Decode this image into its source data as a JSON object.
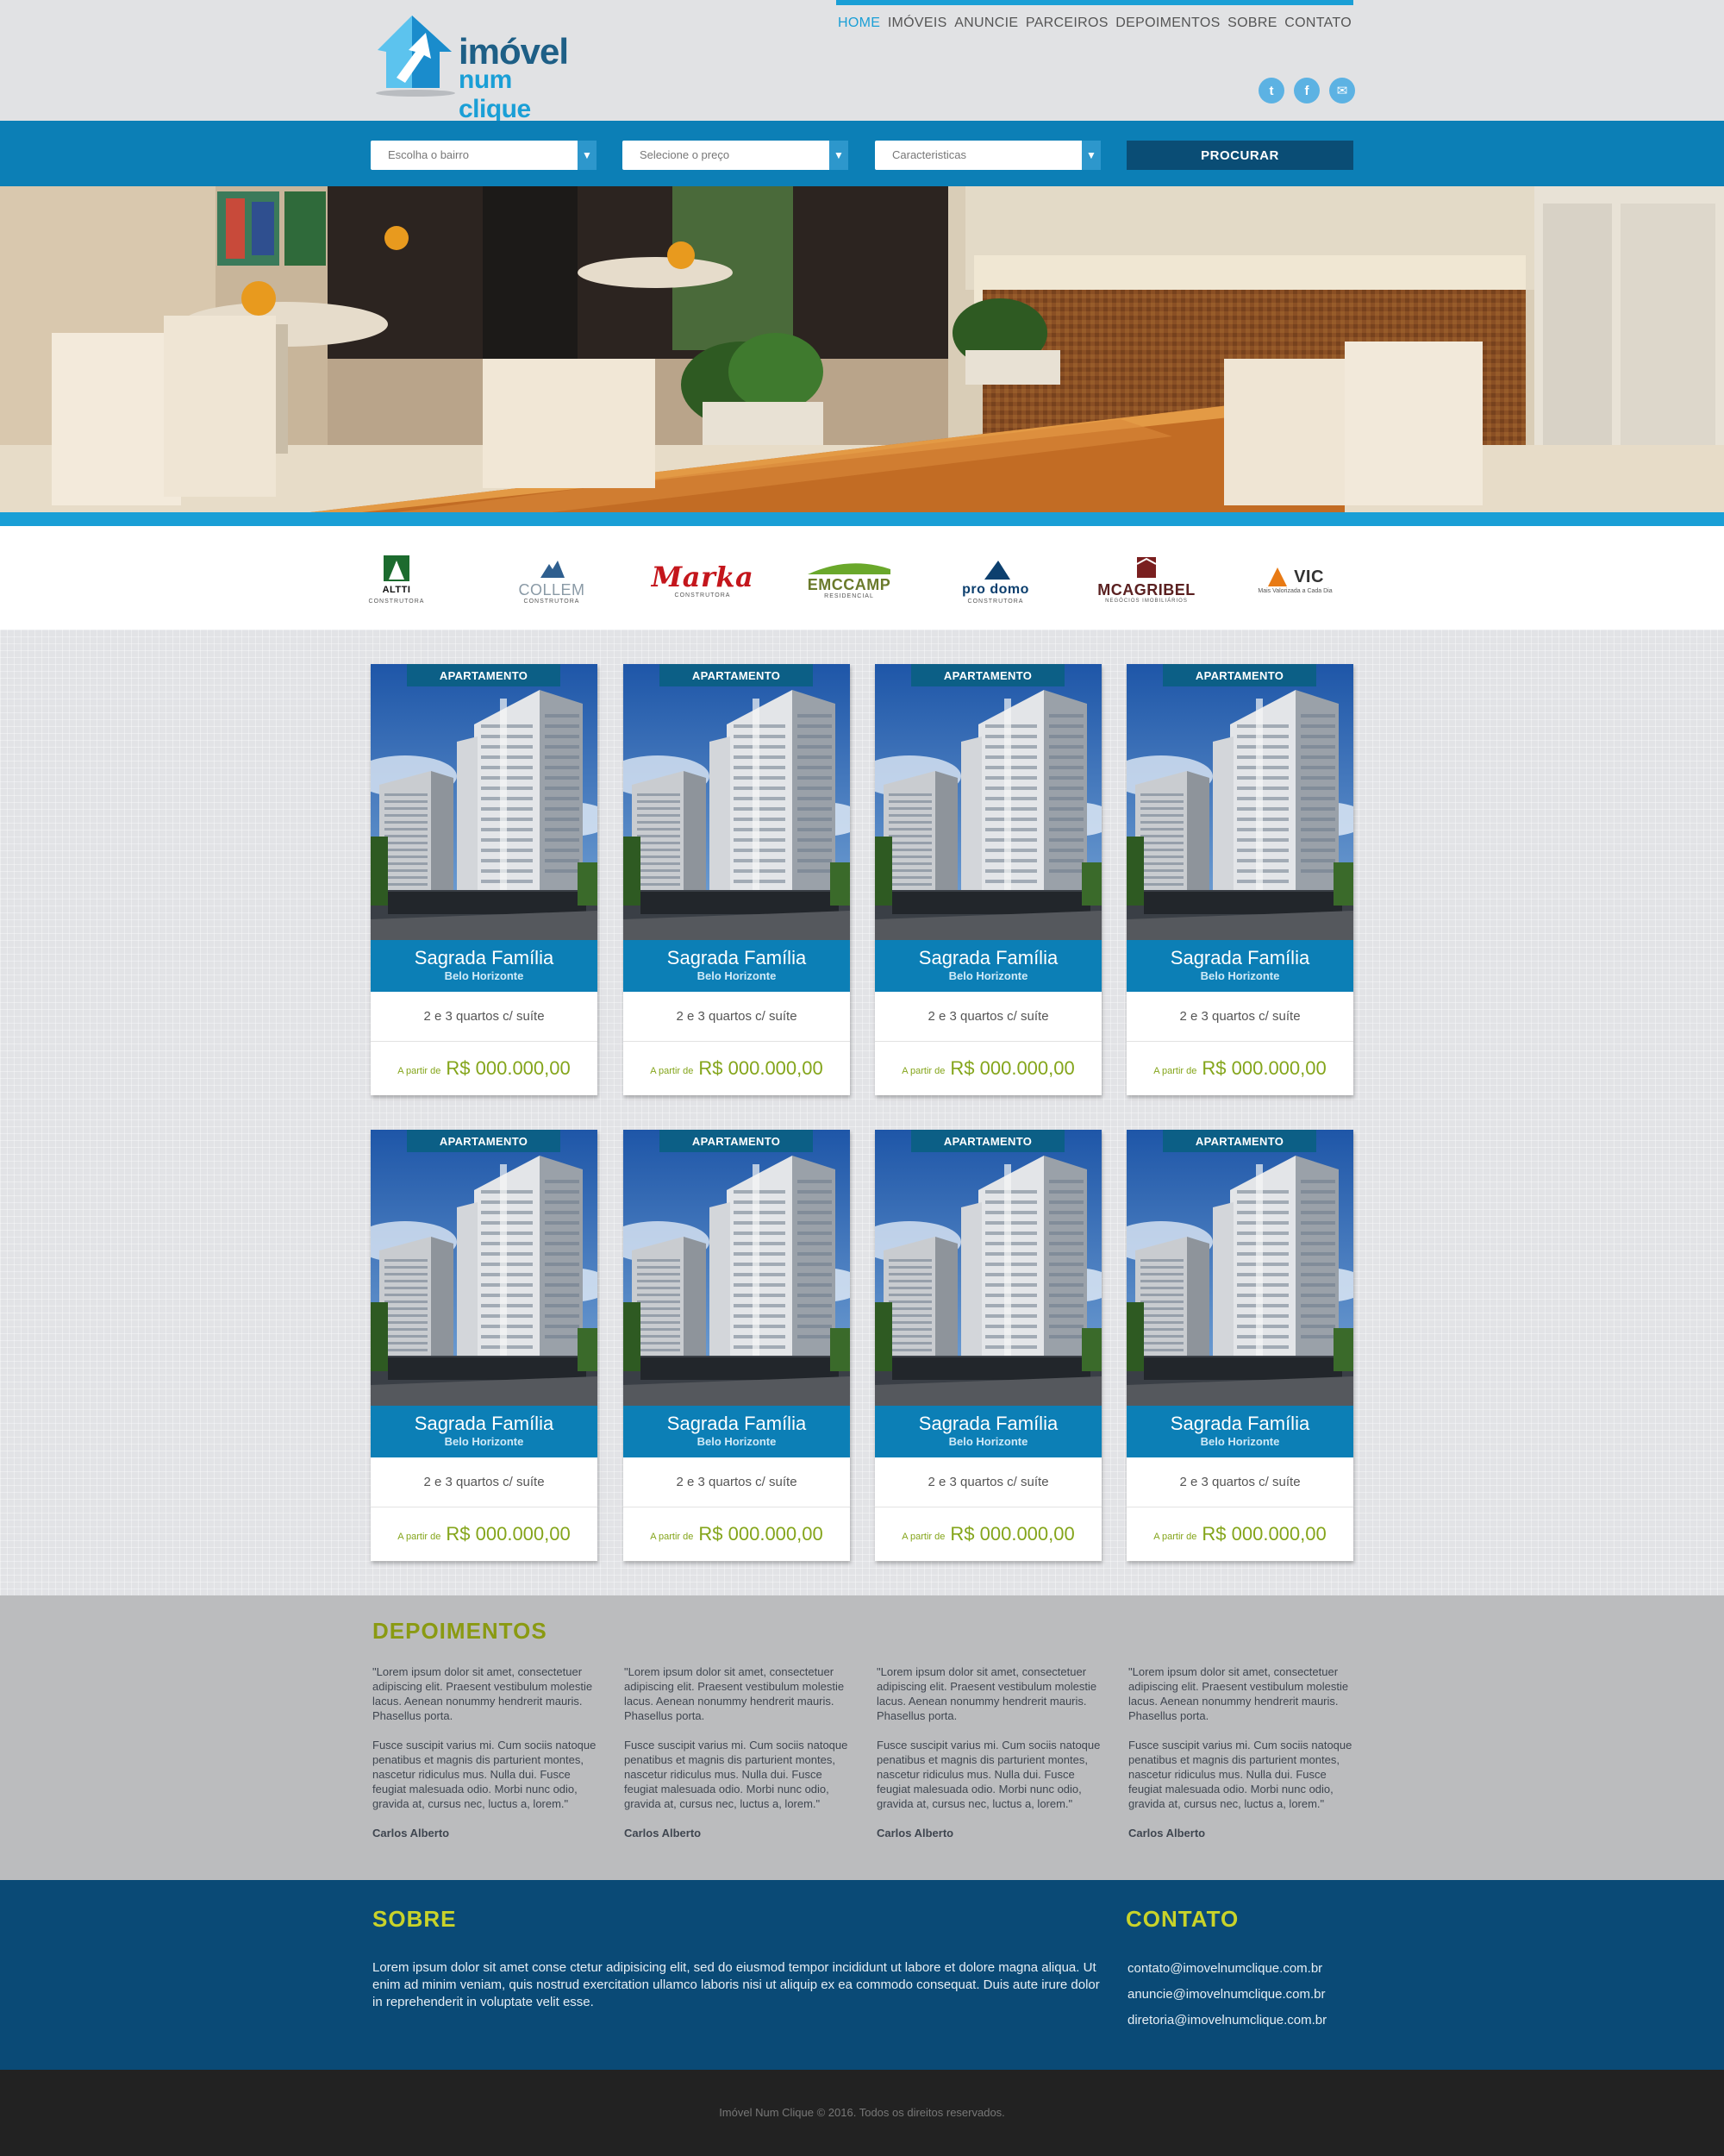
{
  "brand": {
    "line1": "imóvel",
    "line2": "num clique"
  },
  "nav": [
    "HOME",
    "IMÓVEIS",
    "ANUNCIE",
    "PARCEIROS",
    "DEPOIMENTOS",
    "SOBRE",
    "CONTATO"
  ],
  "social": {
    "twitter": "t",
    "facebook": "f",
    "email": "✉"
  },
  "search": {
    "bairro": "Escolha o bairro",
    "preco": "Selecione o preço",
    "caracteristicas": "Caracteristicas",
    "button": "PROCURAR"
  },
  "partners": [
    {
      "name": "ALTTI",
      "sub": "CONSTRUTORA",
      "color": "#1c6b2e"
    },
    {
      "name": "COLLEM",
      "sub": "CONSTRUTORA",
      "color": "#8a9aa6"
    },
    {
      "name": "Marka",
      "sub": "CONSTRUTORA",
      "color": "#c4161c"
    },
    {
      "name": "EMCCAMP",
      "sub": "RESIDENCIAL",
      "color": "#6a8f2b"
    },
    {
      "name": "pro domo",
      "sub": "CONSTRUTORA",
      "color": "#0c3f6e"
    },
    {
      "name": "MCAGRIBEL",
      "sub": "NEGÓCIOS IMOBILIÁRIOS",
      "color": "#7a1f1f"
    },
    {
      "name": "VIC",
      "sub": "Mais Valorizada a Cada Dia",
      "color": "#e87a14"
    }
  ],
  "listings": [
    {
      "tag": "APARTAMENTO",
      "name": "Sagrada Família",
      "city": "Belo Horizonte",
      "rooms": "2 e 3 quartos c/ suíte",
      "price_label": "A partir de",
      "price": "R$ 000.000,00"
    },
    {
      "tag": "APARTAMENTO",
      "name": "Sagrada Família",
      "city": "Belo Horizonte",
      "rooms": "2 e 3 quartos c/ suíte",
      "price_label": "A partir de",
      "price": "R$ 000.000,00"
    },
    {
      "tag": "APARTAMENTO",
      "name": "Sagrada Família",
      "city": "Belo Horizonte",
      "rooms": "2 e 3 quartos c/ suíte",
      "price_label": "A partir de",
      "price": "R$ 000.000,00"
    },
    {
      "tag": "APARTAMENTO",
      "name": "Sagrada Família",
      "city": "Belo Horizonte",
      "rooms": "2 e 3 quartos c/ suíte",
      "price_label": "A partir de",
      "price": "R$ 000.000,00"
    },
    {
      "tag": "APARTAMENTO",
      "name": "Sagrada Família",
      "city": "Belo Horizonte",
      "rooms": "2 e 3 quartos c/ suíte",
      "price_label": "A partir de",
      "price": "R$ 000.000,00"
    },
    {
      "tag": "APARTAMENTO",
      "name": "Sagrada Família",
      "city": "Belo Horizonte",
      "rooms": "2 e 3 quartos c/ suíte",
      "price_label": "A partir de",
      "price": "R$ 000.000,00"
    },
    {
      "tag": "APARTAMENTO",
      "name": "Sagrada Família",
      "city": "Belo Horizonte",
      "rooms": "2 e 3 quartos c/ suíte",
      "price_label": "A partir de",
      "price": "R$ 000.000,00"
    },
    {
      "tag": "APARTAMENTO",
      "name": "Sagrada Família",
      "city": "Belo Horizonte",
      "rooms": "2 e 3 quartos c/ suíte",
      "price_label": "A partir de",
      "price": "R$ 000.000,00"
    }
  ],
  "testimonials": {
    "title": "DEPOIMENTOS",
    "items": [
      {
        "p1": "\"Lorem ipsum dolor sit amet, consectetuer adipiscing elit. Praesent vestibulum molestie lacus. Aenean nonummy hendrerit mauris. Phasellus porta.",
        "p2": "Fusce suscipit varius mi. Cum sociis natoque penatibus et magnis dis parturient montes, nascetur ridiculus mus. Nulla dui. Fusce feugiat malesuada odio. Morbi nunc odio, gravida at, cursus nec, luctus a, lorem.\"",
        "author": "Carlos Alberto"
      },
      {
        "p1": "\"Lorem ipsum dolor sit amet, consectetuer adipiscing elit. Praesent vestibulum molestie lacus. Aenean nonummy hendrerit mauris. Phasellus porta.",
        "p2": "Fusce suscipit varius mi. Cum sociis natoque penatibus et magnis dis parturient montes, nascetur ridiculus mus. Nulla dui. Fusce feugiat malesuada odio. Morbi nunc odio, gravida at, cursus nec, luctus a, lorem.\"",
        "author": "Carlos Alberto"
      },
      {
        "p1": "\"Lorem ipsum dolor sit amet, consectetuer adipiscing elit. Praesent vestibulum molestie lacus. Aenean nonummy hendrerit mauris. Phasellus porta.",
        "p2": "Fusce suscipit varius mi. Cum sociis natoque penatibus et magnis dis parturient montes, nascetur ridiculus mus. Nulla dui. Fusce feugiat malesuada odio. Morbi nunc odio, gravida at, cursus nec, luctus a, lorem.\"",
        "author": "Carlos Alberto"
      },
      {
        "p1": "\"Lorem ipsum dolor sit amet, consectetuer adipiscing elit. Praesent vestibulum molestie lacus. Aenean nonummy hendrerit mauris. Phasellus porta.",
        "p2": "Fusce suscipit varius mi. Cum sociis natoque penatibus et magnis dis parturient montes, nascetur ridiculus mus. Nulla dui. Fusce feugiat malesuada odio. Morbi nunc odio, gravida at, cursus nec, luctus a, lorem.\"",
        "author": "Carlos Alberto"
      }
    ]
  },
  "about": {
    "title": "SOBRE",
    "text": "Lorem ipsum dolor sit amet conse ctetur adipisicing elit, sed do eiusmod tempor incididunt ut labore et dolore magna aliqua. Ut enim ad minim veniam, quis nostrud exercitation ullamco laboris nisi ut aliquip ex ea commodo consequat. Duis aute irure dolor in reprehenderit in voluptate velit esse."
  },
  "contact": {
    "title": "CONTATO",
    "emails": [
      "contato@imovelnumclique.com.br",
      "anuncie@imovelnumclique.com.br",
      "diretoria@imovelnumclique.com.br"
    ]
  },
  "footer": {
    "text": "Imóvel Num Clique © 2016. Todos os direitos reservados."
  },
  "colors": {
    "primary": "#0c7fb6",
    "accent": "#1a9fd6",
    "dark": "#0a4a76",
    "green": "#84a51b",
    "footer": "#222222"
  }
}
